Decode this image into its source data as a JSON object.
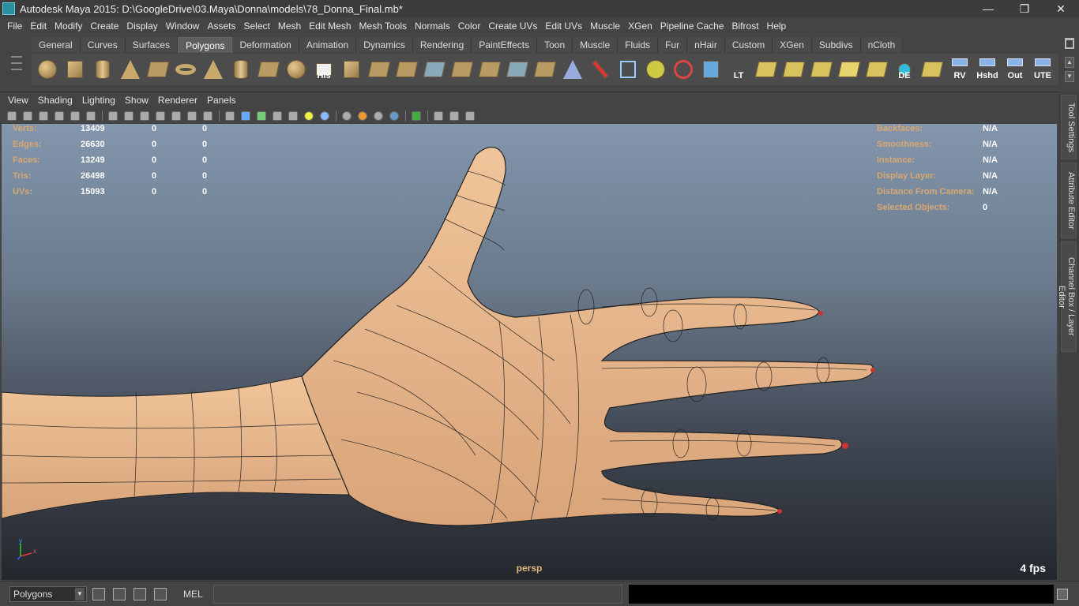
{
  "window": {
    "title": "Autodesk Maya 2015: D:\\GoogleDrive\\03.Maya\\Donna\\models\\78_Donna_Final.mb*",
    "minimize": "—",
    "restore": "❐",
    "close": "✕"
  },
  "menu": [
    "File",
    "Edit",
    "Modify",
    "Create",
    "Display",
    "Window",
    "Assets",
    "Select",
    "Mesh",
    "Edit Mesh",
    "Mesh Tools",
    "Normals",
    "Color",
    "Create UVs",
    "Edit UVs",
    "Muscle",
    "XGen",
    "Pipeline Cache",
    "Bifrost",
    "Help"
  ],
  "shelf_tabs": [
    "General",
    "Curves",
    "Surfaces",
    "Polygons",
    "Deformation",
    "Animation",
    "Dynamics",
    "Rendering",
    "PaintEffects",
    "Toon",
    "Muscle",
    "Fluids",
    "Fur",
    "nHair",
    "Custom",
    "XGen",
    "Subdivs",
    "nCloth"
  ],
  "active_shelf_tab": "Polygons",
  "shelf_labels": {
    "his": "His",
    "lt": "LT",
    "de": "DE",
    "rv": "RV",
    "hshd": "Hshd",
    "out": "Out",
    "ute": "UTE"
  },
  "panel_menu": [
    "View",
    "Shading",
    "Lighting",
    "Show",
    "Renderer",
    "Panels"
  ],
  "hud_left": [
    {
      "label": "Verts:",
      "v1": "13409",
      "v2": "0",
      "v3": "0"
    },
    {
      "label": "Edges:",
      "v1": "26630",
      "v2": "0",
      "v3": "0"
    },
    {
      "label": "Faces:",
      "v1": "13249",
      "v2": "0",
      "v3": "0"
    },
    {
      "label": "Tris:",
      "v1": "26498",
      "v2": "0",
      "v3": "0"
    },
    {
      "label": "UVs:",
      "v1": "15093",
      "v2": "0",
      "v3": "0"
    }
  ],
  "hud_right": [
    {
      "label": "Backfaces:",
      "value": "N/A"
    },
    {
      "label": "Smoothness:",
      "value": "N/A"
    },
    {
      "label": "Instance:",
      "value": "N/A"
    },
    {
      "label": "Display Layer:",
      "value": "N/A"
    },
    {
      "label": "Distance From Camera:",
      "value": "N/A"
    },
    {
      "label": "Selected Objects:",
      "value": "0"
    }
  ],
  "viewport": {
    "camera": "persp",
    "fps": "4 fps",
    "axis_y": "y",
    "axis_x": "x"
  },
  "side_tabs": {
    "tool_settings": "Tool Settings",
    "attribute_editor": "Attribute Editor",
    "channel_box": "Channel Box / Layer Editor"
  },
  "status": {
    "mode": "Polygons",
    "mel_label": "MEL"
  },
  "colors": {
    "mesh": "#e6b48a",
    "wire": "#1a1a1a",
    "hud_label": "#d9a870"
  }
}
